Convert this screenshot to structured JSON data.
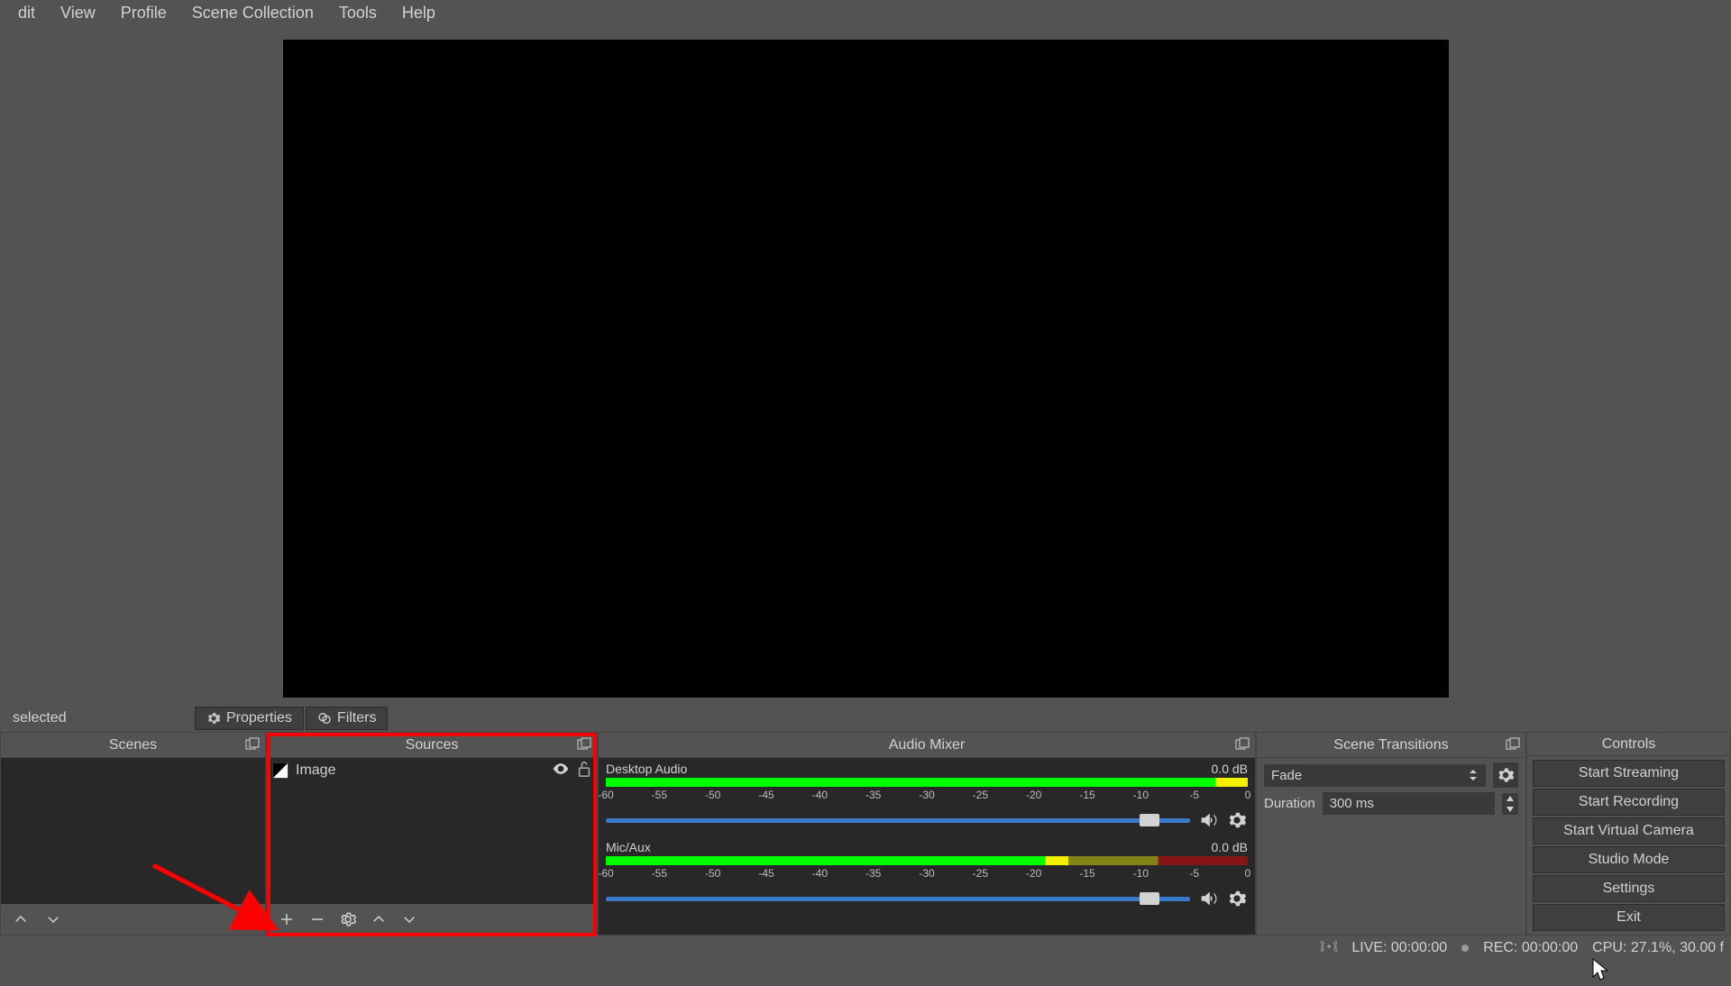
{
  "menu": {
    "edit": "dit",
    "view": "View",
    "profile": "Profile",
    "scene_collection": "Scene Collection",
    "tools": "Tools",
    "help": "Help"
  },
  "info_bar": {
    "selected": "selected",
    "properties": "Properties",
    "filters": "Filters"
  },
  "panels": {
    "scenes_title": "Scenes",
    "sources_title": "Sources",
    "mixer_title": "Audio Mixer",
    "transitions_title": "Scene Transitions",
    "controls_title": "Controls"
  },
  "sources": {
    "items": [
      {
        "label": "Image"
      }
    ]
  },
  "mixer": {
    "channels": [
      {
        "name": "Desktop Audio",
        "db": "0.0 dB",
        "fill_pct": 100
      },
      {
        "name": "Mic/Aux",
        "db": "0.0 dB",
        "fill_pct": 72
      }
    ],
    "ticks": [
      "-60",
      "-55",
      "-50",
      "-45",
      "-40",
      "-35",
      "-30",
      "-25",
      "-20",
      "-15",
      "-10",
      "-5",
      "0"
    ]
  },
  "transitions": {
    "type": "Fade",
    "duration_label": "Duration",
    "duration_value": "300 ms"
  },
  "controls": {
    "start_streaming": "Start Streaming",
    "start_recording": "Start Recording",
    "start_virtual_camera": "Start Virtual Camera",
    "studio_mode": "Studio Mode",
    "settings": "Settings",
    "exit": "Exit"
  },
  "status": {
    "live": "LIVE: 00:00:00",
    "rec": "REC: 00:00:00",
    "cpu": "CPU: 27.1%, 30.00 f"
  }
}
